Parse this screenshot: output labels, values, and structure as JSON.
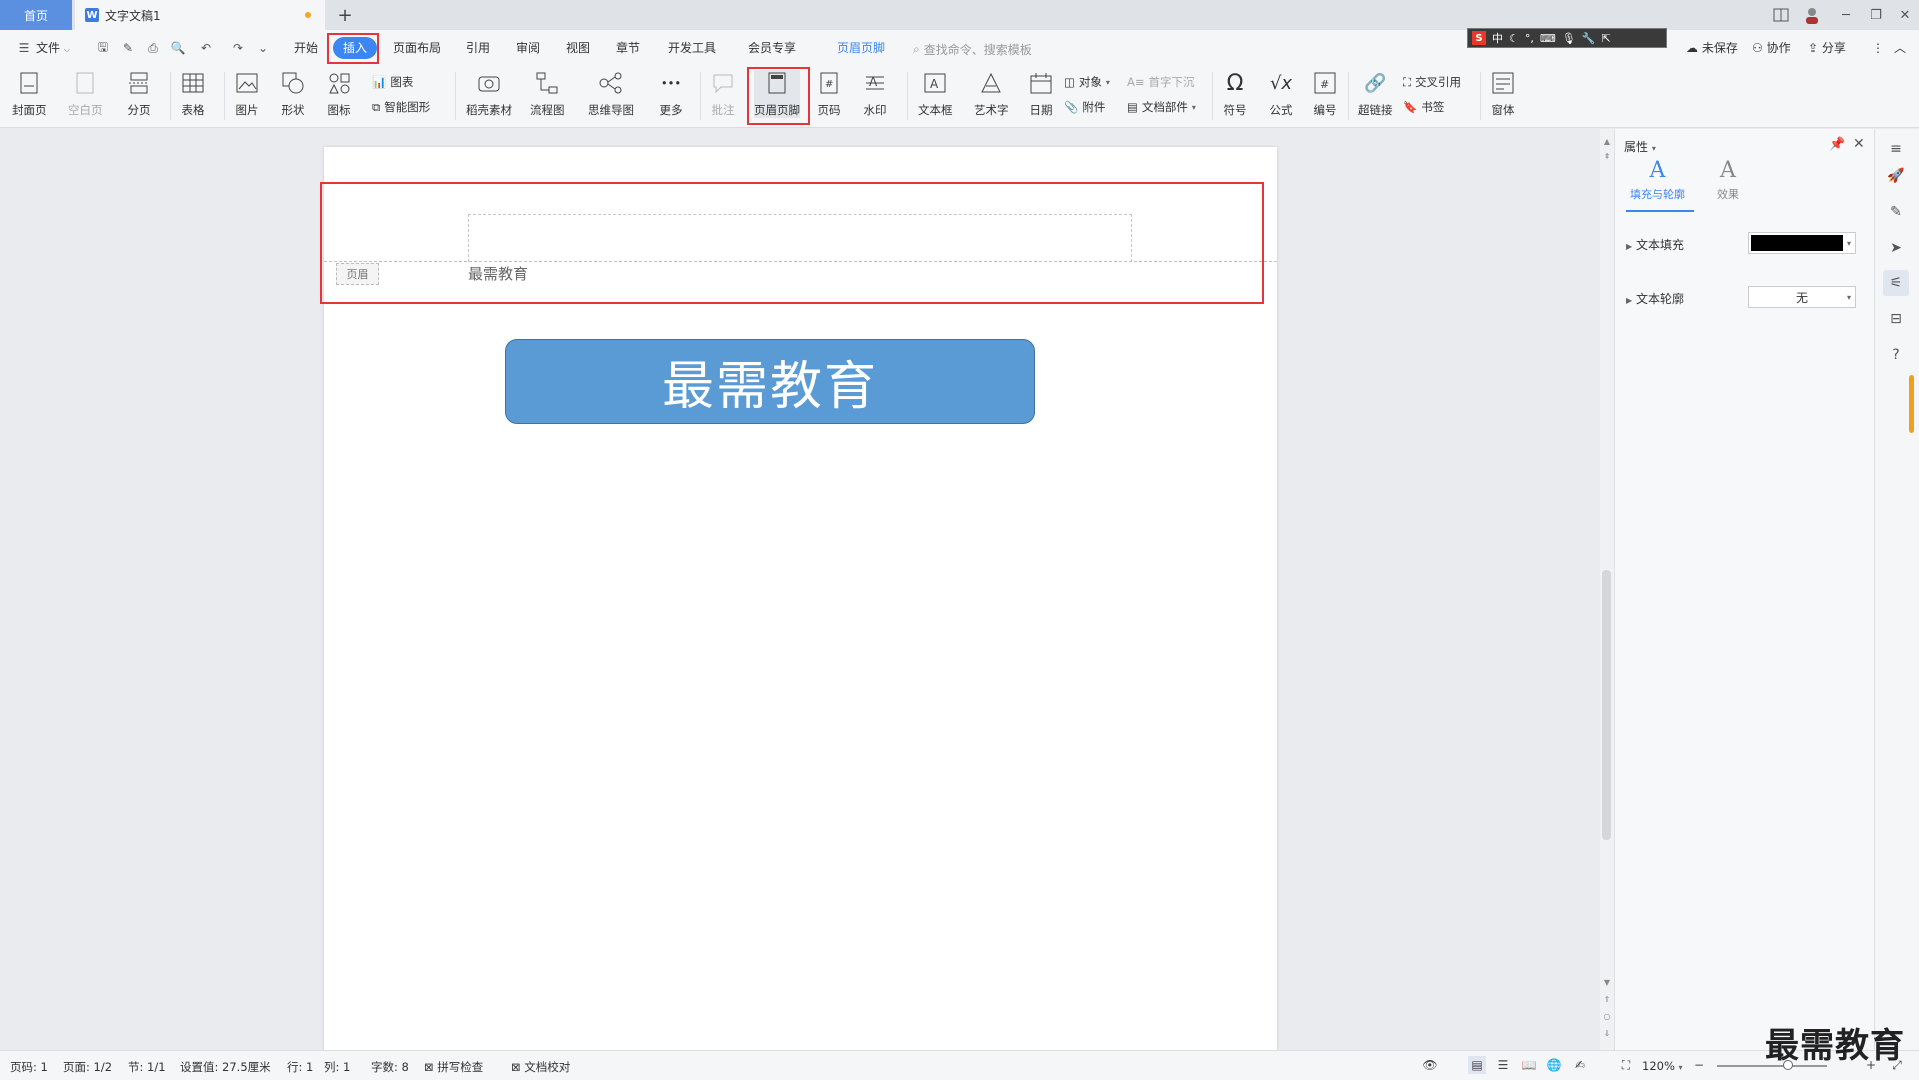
{
  "tabs": {
    "home": "首页",
    "doc": "文字文稿1",
    "add": "+"
  },
  "menu": {
    "file": "文件",
    "items": [
      "开始",
      "插入",
      "页面布局",
      "引用",
      "审阅",
      "视图",
      "章节",
      "开发工具",
      "会员专享",
      "页眉页脚"
    ],
    "search_placeholder": "查找命令、搜索模板",
    "unsaved": "未保存",
    "collab": "协作",
    "share": "分享"
  },
  "ime": {
    "logo": "S",
    "lang": "中"
  },
  "ribbon": {
    "cover": "封面页",
    "blank": "空白页",
    "pagebreak": "分页",
    "table": "表格",
    "picture": "图片",
    "shape": "形状",
    "icon": "图标",
    "chart": "图表",
    "smartart": "智能图形",
    "material": "稻壳素材",
    "flow": "流程图",
    "mindmap": "思维导图",
    "more": "更多",
    "comment": "批注",
    "headerfooter": "页眉页脚",
    "pagenum": "页码",
    "watermark": "水印",
    "textbox": "文本框",
    "wordart": "艺术字",
    "date": "日期",
    "object": "对象",
    "attachment": "附件",
    "dropcap": "首字下沉",
    "docpart": "文档部件",
    "symbol": "符号",
    "equation": "公式",
    "numbering": "编号",
    "hyperlink": "超链接",
    "crossref": "交叉引用",
    "bookmark": "书签",
    "window": "窗体"
  },
  "document": {
    "header_tag": "页眉",
    "header_text": "最需教育",
    "banner_text": "最需教育"
  },
  "panel": {
    "title": "属性",
    "tab_fill": "填充与轮廓",
    "tab_effect": "效果",
    "text_fill_label": "文本填充",
    "text_fill_color": "#000000",
    "text_outline_label": "文本轮廓",
    "text_outline_value": "无"
  },
  "status": {
    "page": "页码: 1",
    "pages": "页面: 1/2",
    "section": "节: 1/1",
    "setting": "设置值: 27.5厘米",
    "row": "行: 1",
    "col": "列: 1",
    "words": "字数: 8",
    "spell": "拼写检查",
    "proof": "文档校对",
    "zoom": "120%"
  },
  "watermark_text": "最需教育",
  "colors": {
    "accent": "#3b86f2",
    "highlight": "#e5343a",
    "banner": "#5b9bd5"
  }
}
